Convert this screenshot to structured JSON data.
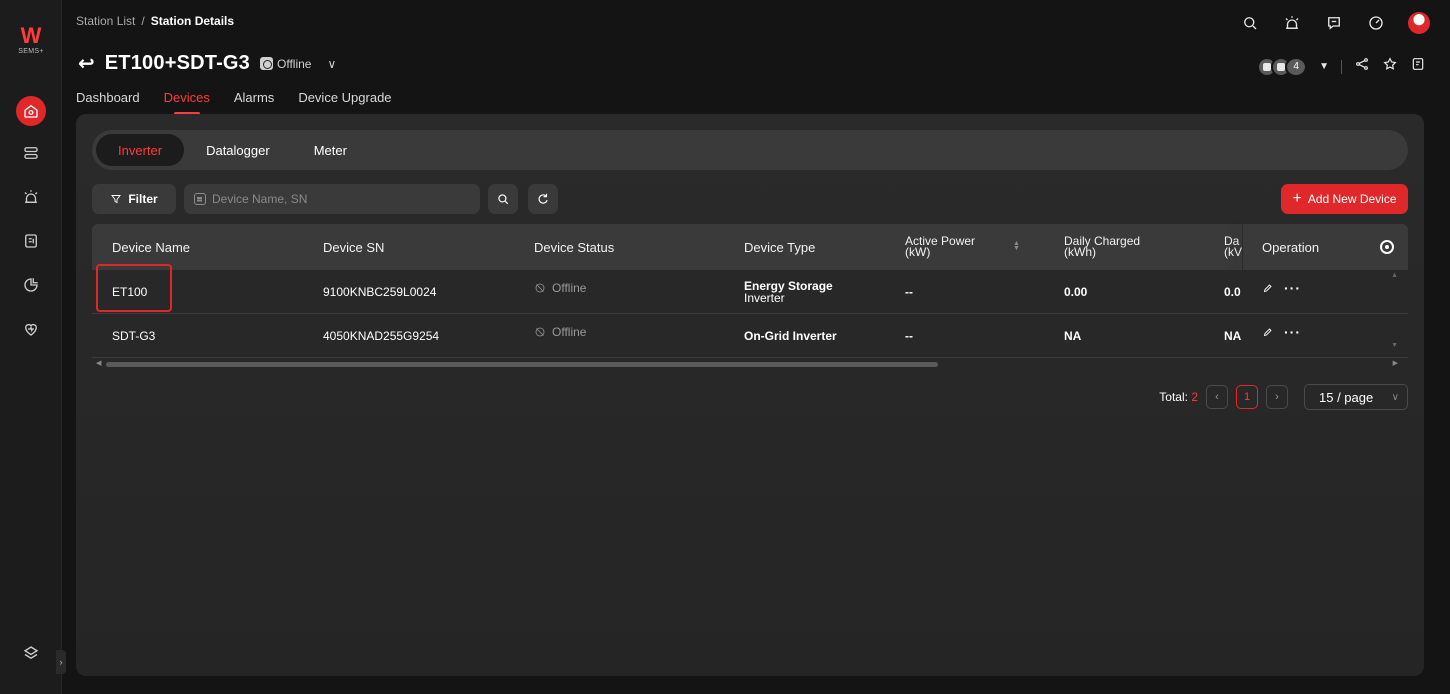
{
  "app": {
    "logo_text": "SEMS+"
  },
  "breadcrumb": {
    "parent": "Station List",
    "separator": "/",
    "current": "Station Details"
  },
  "station": {
    "name": "ET100+SDT-G3",
    "status": "Offline"
  },
  "tabs": [
    {
      "label": "Dashboard"
    },
    {
      "label": "Devices",
      "active": true
    },
    {
      "label": "Alarms"
    },
    {
      "label": "Device Upgrade"
    }
  ],
  "collaborators": {
    "count": "4"
  },
  "device_categories": [
    {
      "label": "Inverter",
      "active": true
    },
    {
      "label": "Datalogger"
    },
    {
      "label": "Meter"
    }
  ],
  "toolbar": {
    "filter_label": "Filter",
    "search_placeholder": "Device Name, SN",
    "add_label": "Add New Device"
  },
  "table": {
    "headers": {
      "name": "Device Name",
      "sn": "Device SN",
      "status": "Device Status",
      "type": "Device Type",
      "active_power_1": "Active Power",
      "active_power_2": "(kW)",
      "daily_charged_1": "Daily Charged",
      "daily_charged_2": "(kWh)",
      "daily_dis_1": "Da",
      "daily_dis_2": "(kV",
      "operation": "Operation"
    },
    "rows": [
      {
        "name": "ET100",
        "sn": "9100KNBC259L0024",
        "status": "Offline",
        "type_1": "Energy Storage",
        "type_2": "Inverter",
        "active_power": "--",
        "daily_charged": "0.00",
        "daily_dis": "0.0",
        "highlighted": true
      },
      {
        "name": "SDT-G3",
        "sn": "4050KNAD255G9254",
        "status": "Offline",
        "type_1": "On-Grid Inverter",
        "type_2": "",
        "active_power": "--",
        "daily_charged": "NA",
        "daily_dis": "NA"
      }
    ]
  },
  "pagination": {
    "total_label": "Total:",
    "total": "2",
    "current_page": "1",
    "page_size": "15 / page"
  },
  "colors": {
    "accent": "#e0282a",
    "background": "#141414",
    "panel": "#2a2a2a"
  }
}
